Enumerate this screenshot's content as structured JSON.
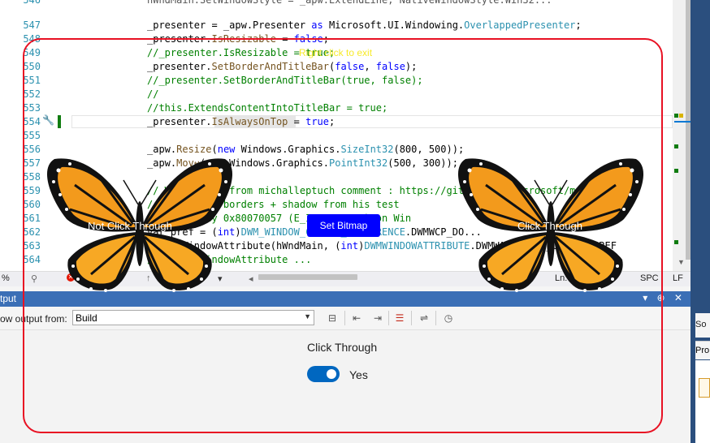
{
  "editor": {
    "lines": [
      {
        "n": "546",
        "text": ""
      },
      {
        "n": "547",
        "text": ""
      },
      {
        "n": "548",
        "text": ""
      },
      {
        "n": "549",
        "text": ""
      },
      {
        "n": "550",
        "text": ""
      },
      {
        "n": "551",
        "text": ""
      },
      {
        "n": "552",
        "text": ""
      },
      {
        "n": "553",
        "text": ""
      },
      {
        "n": "554",
        "text": ""
      },
      {
        "n": "555",
        "text": ""
      },
      {
        "n": "556",
        "text": ""
      },
      {
        "n": "557",
        "text": ""
      },
      {
        "n": "558",
        "text": ""
      },
      {
        "n": "559",
        "text": ""
      },
      {
        "n": "560",
        "text": ""
      },
      {
        "n": "561",
        "text": ""
      },
      {
        "n": "562",
        "text": ""
      },
      {
        "n": "563",
        "text": ""
      },
      {
        "n": "564",
        "text": ""
      }
    ],
    "code_top": "hWndMain.SetWindowStyle = _apw.ExtendLine, NativeWindowStyle.Win32...",
    "code": {
      "l547_a": "_presenter = _apw.Presenter ",
      "l547_kw": "as",
      "l547_b": " Microsoft.UI.Windowing.",
      "l547_ty": "OverlappedPresenter",
      "l547_c": ";",
      "l548_a": "_presenter.",
      "l548_mb": "IsResizable",
      "l548_b": " = ",
      "l548_kw": "false",
      "l548_c": ";",
      "l549": "//_presenter.IsResizable = true;",
      "l550_a": "_presenter.",
      "l550_mb": "SetBorderAndTitleBar",
      "l550_b": "(",
      "l550_k1": "false",
      "l550_c": ", ",
      "l550_k2": "false",
      "l550_d": ");",
      "l551": "//_presenter.SetBorderAndTitleBar(true, false);",
      "l552": "//",
      "l553": "//this.ExtendsContentIntoTitleBar = true;",
      "l554_a": "_presenter.",
      "l554_mb": "IsAlwaysOnTop",
      "l554_b": " = ",
      "l554_kw": "true",
      "l554_c": ";",
      "l556_a": "_apw.",
      "l556_mb": "Resize",
      "l556_b": "(",
      "l556_kw": "new",
      "l556_c": " Windows.Graphics.",
      "l556_ty": "SizeInt32",
      "l556_d": "(800, 500));",
      "l557_a": "_apw.",
      "l557_mb": "Move",
      "l557_b": "(",
      "l557_kw": "new",
      "l557_c": " Windows.Graphics.",
      "l557_ty": "PointInt32",
      "l557_d": "(500, 300));",
      "l559": "// Windows 11 from michalleptuch comment : https://github.com/microsoft/mi",
      "l560": "// there are borders + shadow from his test",
      "l561_a": "// logically 0x80070057 (E_INVALIDARG) on Win",
      "l562_a": "var pref = (",
      "l562_kw": "int",
      "l562_b": ")",
      "l562_ty": "DWM_WINDOW_CORNER_PREFERENCE",
      "l562_c": ".DWMWCP_DO...",
      "l563_a": "DwmSetWindowAttribute(hWndMain, (",
      "l563_kw": "int",
      "l563_b": ")",
      "l563_ty": "DWMWINDOWATTRIBUTE",
      "l563_c": ".DWMWA_WINDOW_CORNER_PREF",
      "l564": "// DwmSetWindowAttribute ..."
    }
  },
  "statusbar": {
    "zoom": "%",
    "line_info": "Ln: 554",
    "encoding": "SPC",
    "eol": "LF"
  },
  "output": {
    "title": "tput",
    "controls": "▾ ⊕ ✕",
    "show_from_label": "ow output from:",
    "source": "Build"
  },
  "overlay": {
    "hint": "Right click to exit",
    "button_label": "Set Bitmap",
    "click_through_label": "Click Through",
    "toggle_state": "Yes",
    "toggle_on": true,
    "left_butterfly_label": "Not Click Through",
    "right_butterfly_label": "Click Through"
  },
  "right_panel": {
    "top_text": "So",
    "mid_text": "Pro"
  },
  "colors": {
    "frame": "#e81123",
    "button": "#0000ff",
    "toggle": "#0067c0",
    "accent_bar": "#3b6fb6"
  }
}
